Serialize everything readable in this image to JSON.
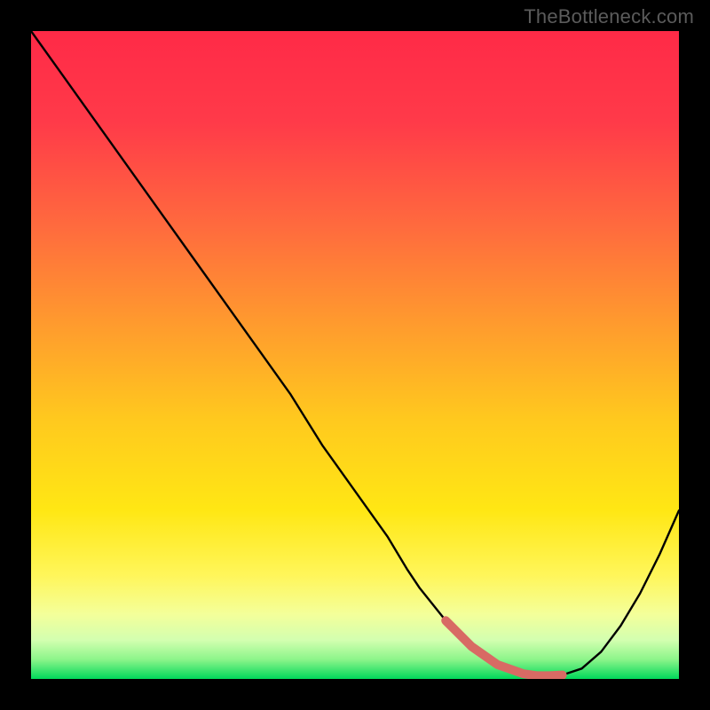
{
  "watermark": "TheBottleneck.com",
  "chart_data": {
    "type": "line",
    "title": "",
    "xlabel": "",
    "ylabel": "",
    "xlim": [
      0,
      100
    ],
    "ylim": [
      0,
      100
    ],
    "grid": false,
    "legend": false,
    "series": [
      {
        "name": "bottleneck-curve",
        "x": [
          0,
          5,
          10,
          15,
          20,
          25,
          30,
          35,
          40,
          45,
          50,
          55,
          58,
          60,
          64,
          68,
          72,
          76,
          78,
          80,
          82,
          85,
          88,
          91,
          94,
          97,
          100
        ],
        "values": [
          100,
          93,
          86,
          79,
          72,
          65,
          58,
          51,
          44,
          36,
          29,
          22,
          17,
          14,
          9,
          5,
          2.2,
          0.8,
          0.5,
          0.5,
          0.6,
          1.6,
          4.2,
          8.2,
          13.2,
          19.2,
          26
        ]
      }
    ],
    "highlight_segment": {
      "name": "optimal-range",
      "x": [
        64,
        68,
        72,
        76,
        78,
        80,
        82
      ],
      "values": [
        9,
        5,
        2.2,
        0.8,
        0.5,
        0.5,
        0.6
      ],
      "color": "#d86a64"
    },
    "gradient_background": {
      "type": "conceptual-heatmap",
      "top": "#ff2f4b",
      "mid": "#ffd400",
      "low": "#f6ffa8",
      "bottom": "#00e060",
      "stops_pct": [
        0,
        45,
        75,
        88,
        95,
        100
      ]
    }
  }
}
